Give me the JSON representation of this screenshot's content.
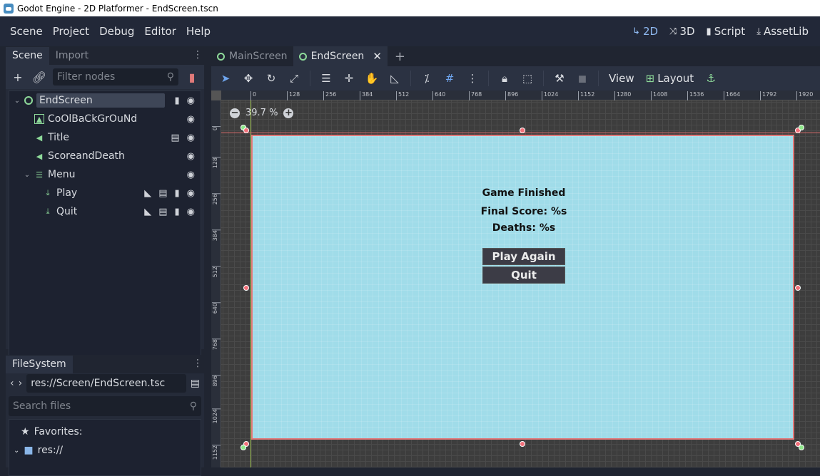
{
  "window": {
    "title": "Godot Engine - 2D Platformer - EndScreen.tscn"
  },
  "menu": [
    "Scene",
    "Project",
    "Debug",
    "Editor",
    "Help"
  ],
  "main_buttons": [
    {
      "label": "2D",
      "icon": "2d-icon",
      "active": true
    },
    {
      "label": "3D",
      "icon": "3d-icon",
      "active": false
    },
    {
      "label": "Script",
      "icon": "script-icon",
      "active": false
    },
    {
      "label": "AssetLib",
      "icon": "assetlib-icon",
      "active": false
    }
  ],
  "scene_dock": {
    "tabs": [
      "Scene",
      "Import"
    ],
    "filter_placeholder": "Filter nodes",
    "nodes": [
      {
        "name": "EndScreen",
        "depth": 0,
        "type": "control",
        "selected": true
      },
      {
        "name": "CoOlBaCkGrOuNd",
        "depth": 1,
        "type": "texture-rect"
      },
      {
        "name": "Title",
        "depth": 1,
        "type": "label"
      },
      {
        "name": "ScoreandDeath",
        "depth": 1,
        "type": "label"
      },
      {
        "name": "Menu",
        "depth": 1,
        "type": "vbox"
      },
      {
        "name": "Play",
        "depth": 2,
        "type": "button"
      },
      {
        "name": "Quit",
        "depth": 2,
        "type": "button"
      }
    ]
  },
  "filesystem_dock": {
    "tab": "FileSystem",
    "path": "res://Screen/EndScreen.tsc",
    "search_placeholder": "Search files",
    "favorites": "Favorites:",
    "root": "res://"
  },
  "editor_tabs": [
    {
      "label": "MainScreen",
      "active": false
    },
    {
      "label": "EndScreen",
      "active": true
    }
  ],
  "canvas_toolbar": {
    "view_label": "View",
    "layout_label": "Layout"
  },
  "viewport": {
    "zoom": "39.7 %",
    "ruler_h": [
      "0",
      "128",
      "256",
      "384",
      "512",
      "640",
      "768",
      "896",
      "1024",
      "1152",
      "1280",
      "1408",
      "1536",
      "1664",
      "1792",
      "1920"
    ],
    "ruler_v": [
      "0",
      "128",
      "256",
      "384",
      "512",
      "640",
      "768",
      "896",
      "1024",
      "1152"
    ]
  },
  "game": {
    "title": "Game Finished",
    "score": "Final Score: %s",
    "deaths": "Deaths: %s",
    "play_button": "Play Again",
    "quit_button": "Quit",
    "background_color": "#a0dce9"
  }
}
